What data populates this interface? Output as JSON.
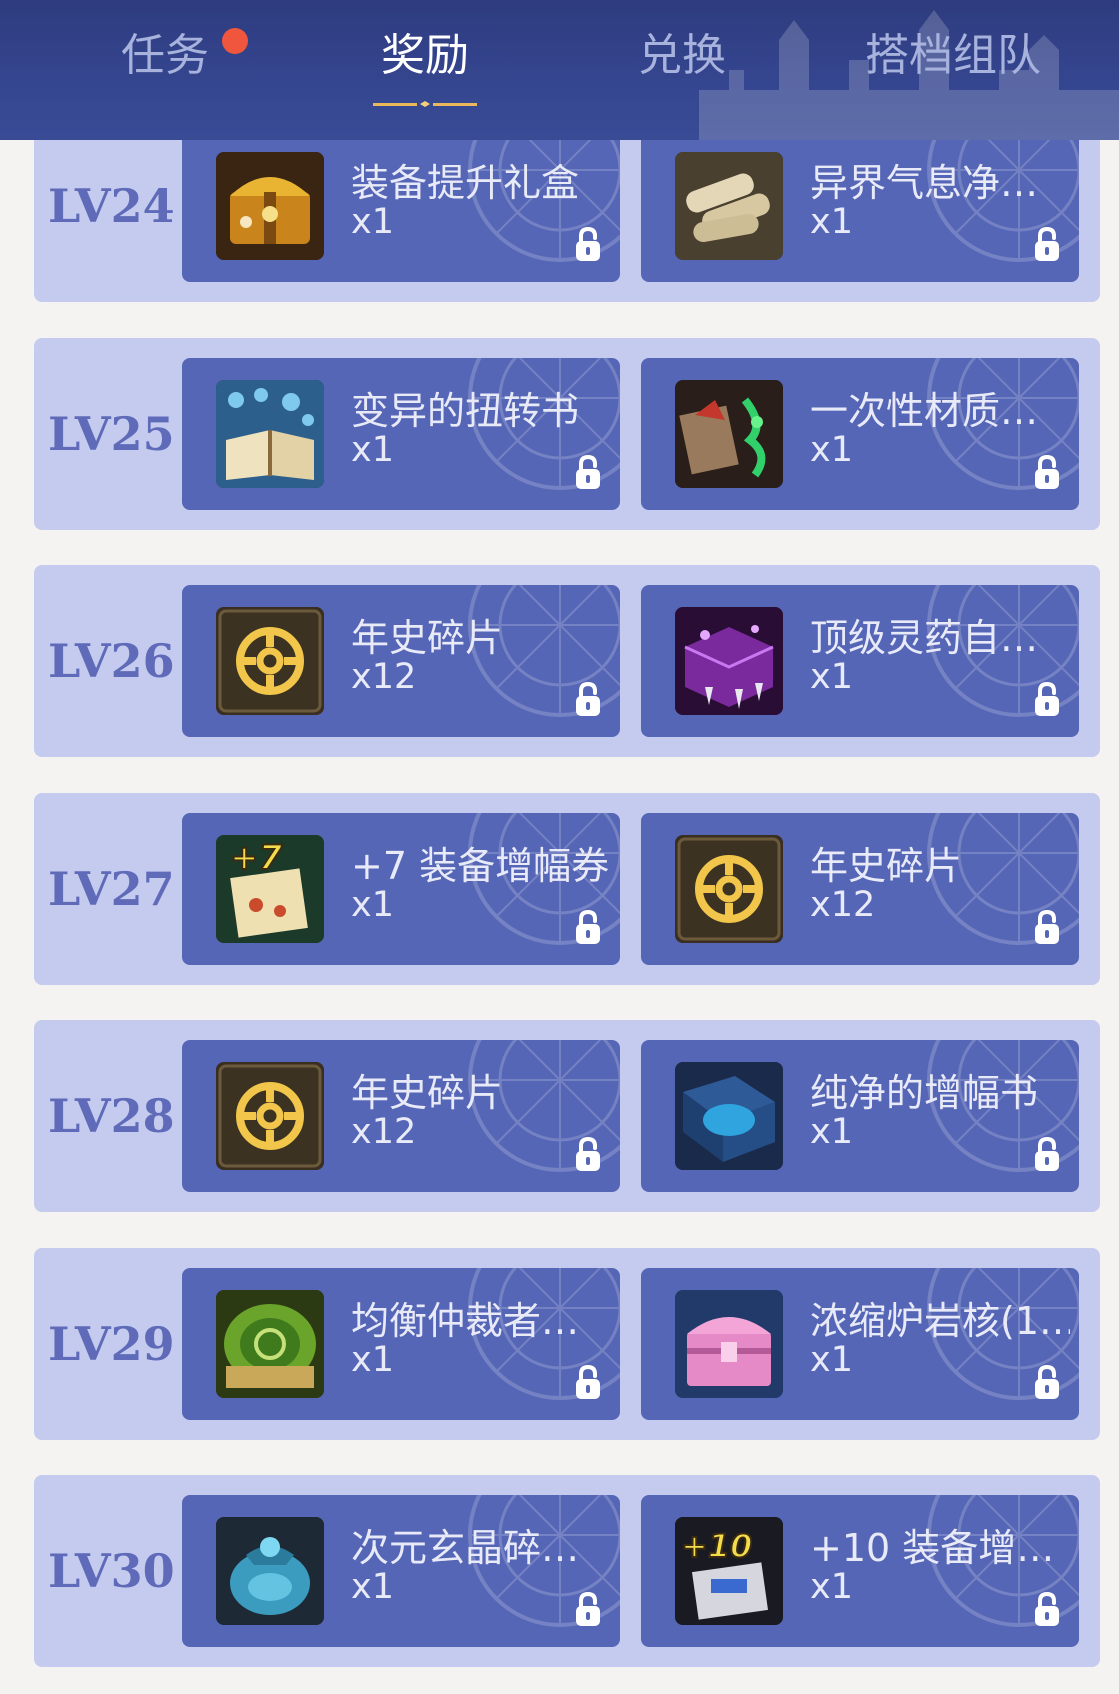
{
  "tabs": [
    {
      "label": "任务",
      "active": false,
      "has_dot": true
    },
    {
      "label": "奖励",
      "active": true,
      "has_dot": false
    },
    {
      "label": "兑换",
      "active": false,
      "has_dot": false
    },
    {
      "label": "搭档组队",
      "active": false,
      "has_dot": false
    }
  ],
  "colors": {
    "header_bg": "#33428a",
    "row_bg": "#c4cbef",
    "card_bg": "#5666b6",
    "level_text": "#5f6bb8",
    "badge_dot": "#f0553e",
    "active_underline": "#e8b85a"
  },
  "rewards": [
    {
      "level": "LV24",
      "items": [
        {
          "name": "装备提升礼盒",
          "qty": "x1",
          "icon": "golden-chest-icon",
          "locked": true
        },
        {
          "name": "异界气息净…",
          "qty": "x1",
          "icon": "scroll-bundle-icon",
          "locked": true
        }
      ]
    },
    {
      "level": "LV25",
      "items": [
        {
          "name": "变异的扭转书",
          "qty": "x1",
          "icon": "open-book-icon",
          "locked": true
        },
        {
          "name": "一次性材质…",
          "qty": "x1",
          "icon": "material-box-icon",
          "locked": true
        }
      ]
    },
    {
      "level": "LV26",
      "items": [
        {
          "name": "年史碎片",
          "qty": "x12",
          "icon": "chronicle-fragment-icon",
          "locked": true
        },
        {
          "name": "顶级灵药自…",
          "qty": "x1",
          "icon": "elixir-crate-icon",
          "locked": true
        }
      ]
    },
    {
      "level": "LV27",
      "items": [
        {
          "name": "+7 装备增幅券",
          "qty": "x1",
          "icon": "amplify-ticket-plus7-icon",
          "locked": true
        },
        {
          "name": "年史碎片",
          "qty": "x12",
          "icon": "chronicle-fragment-icon",
          "locked": true
        }
      ]
    },
    {
      "level": "LV28",
      "items": [
        {
          "name": "年史碎片",
          "qty": "x12",
          "icon": "chronicle-fragment-icon",
          "locked": true
        },
        {
          "name": "纯净的增幅书",
          "qty": "x1",
          "icon": "blue-tome-icon",
          "locked": true
        }
      ]
    },
    {
      "level": "LV29",
      "items": [
        {
          "name": "均衡仲裁者…",
          "qty": "x1",
          "icon": "green-emblem-icon",
          "locked": true
        },
        {
          "name": "浓缩炉岩核(1…",
          "qty": "x1",
          "icon": "pink-chest-icon",
          "locked": true
        }
      ]
    },
    {
      "level": "LV30",
      "items": [
        {
          "name": "次元玄晶碎…",
          "qty": "x1",
          "icon": "crystal-pouch-icon",
          "locked": true
        },
        {
          "name": "+10 装备增…",
          "qty": "x1",
          "icon": "amplify-ticket-plus10-icon",
          "locked": true
        }
      ]
    }
  ]
}
